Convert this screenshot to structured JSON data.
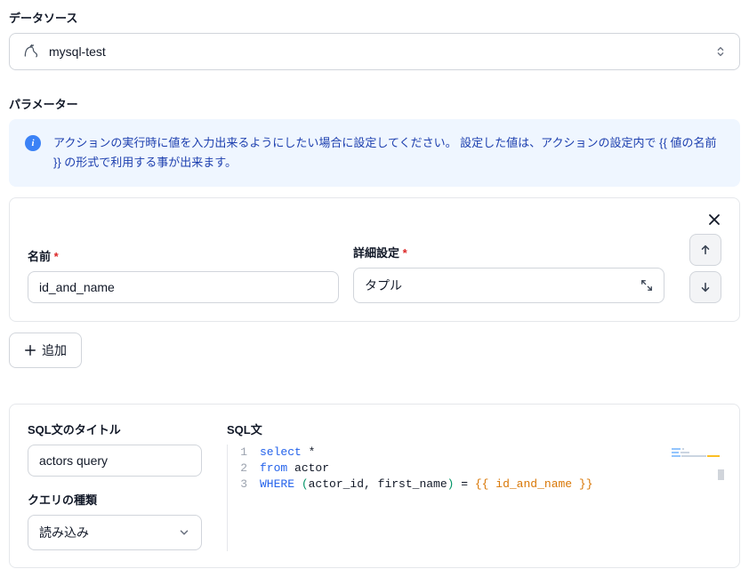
{
  "datasource": {
    "label": "データソース",
    "selected": "mysql-test"
  },
  "parameter": {
    "label": "パラメーター",
    "info_text": "アクションの実行時に値を入力出来るようにしたい場合に設定してください。 設定した値は、アクションの設定内で {{ 値の名前 }} の形式で利用する事が出来ます。",
    "name_label": "名前",
    "name_value": "id_and_name",
    "detail_label": "詳細設定",
    "detail_value": "タプル",
    "add_label": "追加"
  },
  "sql": {
    "title_label": "SQL文のタイトル",
    "title_value": "actors query",
    "query_type_label": "クエリの種類",
    "query_type_value": "読み込み",
    "sql_label": "SQL文",
    "code": {
      "l1_select": "select",
      "l1_star": " *",
      "l2_from": "from",
      "l2_tbl": " actor",
      "l3_where": "WHERE ",
      "l3_lp": "(",
      "l3_cols": "actor_id, first_name",
      "l3_rp": ")",
      "l3_eq": " = ",
      "l3_param": "{{ id_and_name }}",
      "n1": "1",
      "n2": "2",
      "n3": "3"
    }
  }
}
